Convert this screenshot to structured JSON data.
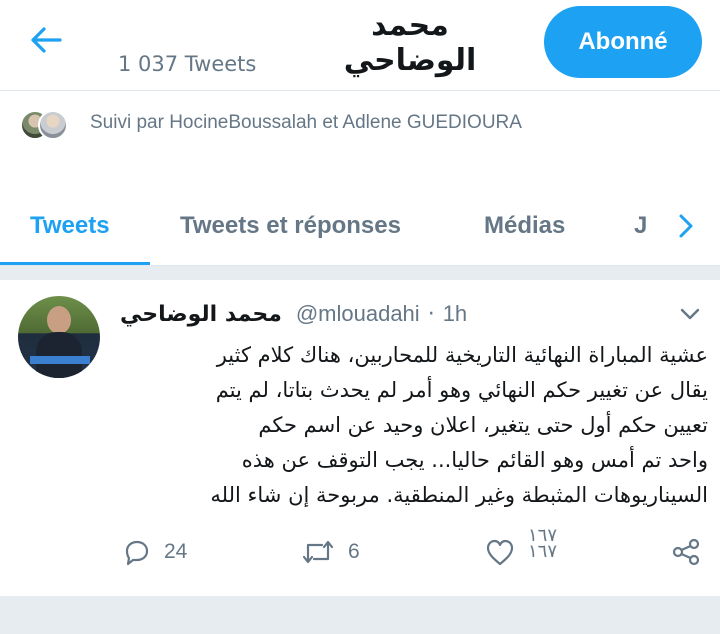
{
  "header": {
    "profile_name": "محمد الوضاحي",
    "tweet_count": "1 037 Tweets",
    "follow_label": "Abonné",
    "back_icon": "arrow-left-icon"
  },
  "followed_by": {
    "text": "Suivi par HocineBoussalah et Adlene GUEDIOURA"
  },
  "tabs": {
    "items": [
      {
        "label": "Tweets"
      },
      {
        "label": "Tweets et réponses"
      },
      {
        "label": "Médias"
      },
      {
        "label": "J"
      }
    ],
    "next_icon": "chevron-right-icon"
  },
  "tweet": {
    "author_name": "محمد الوضاحي",
    "handle": "@mlouadahi",
    "separator": "·",
    "time": "1h",
    "text": "عشية المباراة النهائية التاريخية للمحاربين، هناك كلام كثير\nيقال عن تغيير حكم النهائي وهو أمر لم يحدث بتاتا، لم يتم\nتعيين حكم أول حتى يتغير، اعلان وحيد عن اسم حكم\nواحد تم أمس وهو القائم حاليا...  يجب التوقف عن هذه\nالسيناريوهات المثبطة وغير المنطقية. مربوحة إن شاء الله",
    "replies": "24",
    "retweets": "6",
    "likes": "١٦٧\n١٦٧"
  },
  "colors": {
    "accent": "#1da1f2",
    "muted": "#657786",
    "text": "#14171a",
    "separator_bg": "#e6ecf0"
  }
}
